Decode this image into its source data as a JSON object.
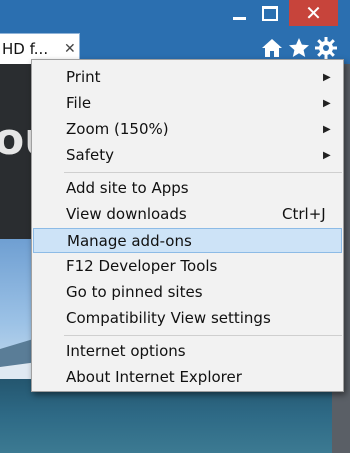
{
  "window": {
    "minimize_icon": "minimize-icon",
    "maximize_icon": "maximize-icon",
    "close_glyph": "✕"
  },
  "tab": {
    "title": "HD f...",
    "close_glyph": "✕"
  },
  "toolbar": {
    "icons": [
      "home-icon",
      "star-icon",
      "gear-icon"
    ]
  },
  "page_background": {
    "hero_text": "ou"
  },
  "menu": {
    "groups": [
      [
        {
          "label": "Print",
          "submenu": true
        },
        {
          "label": "File",
          "submenu": true
        },
        {
          "label": "Zoom (150%)",
          "submenu": true
        },
        {
          "label": "Safety",
          "submenu": true
        }
      ],
      [
        {
          "label": "Add site to Apps"
        },
        {
          "label": "View downloads",
          "shortcut": "Ctrl+J"
        },
        {
          "label": "Manage add-ons",
          "highlighted": true
        },
        {
          "label": "F12 Developer Tools"
        },
        {
          "label": "Go to pinned sites"
        },
        {
          "label": "Compatibility View settings"
        }
      ],
      [
        {
          "label": "Internet options"
        },
        {
          "label": "About Internet Explorer"
        }
      ]
    ],
    "submenu_arrow": "▶"
  },
  "colors": {
    "titlebar": "#2b6fb0",
    "close_button": "#c7443b",
    "menu_background": "#f2f2f2",
    "highlight": "#cde3f7"
  }
}
